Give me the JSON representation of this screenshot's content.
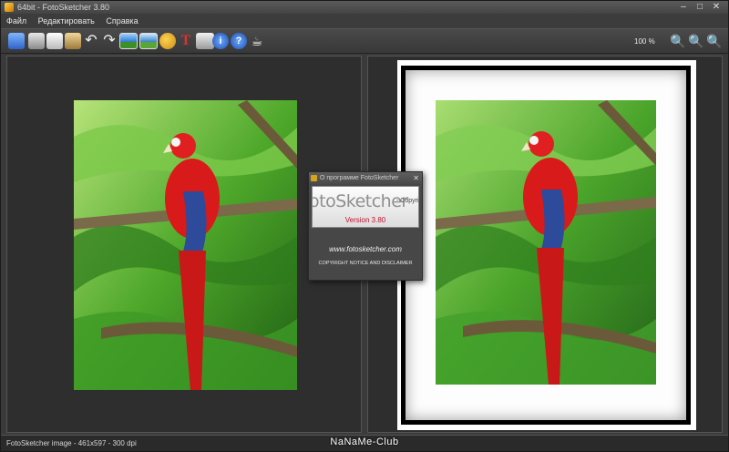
{
  "window": {
    "title": "64bit - FotoSketcher 3.80",
    "minimize": "–",
    "maximize": "□",
    "close": "✕"
  },
  "menu": {
    "items": [
      {
        "label": "Файл"
      },
      {
        "label": "Редактировать"
      },
      {
        "label": "Справка"
      }
    ]
  },
  "toolbar": {
    "zoom_level": "100 %",
    "icons": [
      "open-icon",
      "save-icon",
      "copy-icon",
      "paste-icon",
      "undo-icon",
      "redo-icon",
      "image-icon",
      "image-alt-icon",
      "palette-icon",
      "text-icon",
      "print-icon",
      "info-icon",
      "help-icon",
      "coffee-icon",
      "zoom-out-icon",
      "zoom-fit-icon",
      "zoom-in-icon"
    ]
  },
  "about_dialog": {
    "title": "О программе FotoSketcher",
    "close": "✕",
    "logo_text": "otoSketcher",
    "copyright_fragment": "- Copyri",
    "version": "Version 3.80",
    "website": "www.fotosketcher.com",
    "notice": "COPYRIGHT NOTICE AND DISCLAIMER"
  },
  "status": {
    "text": "FotoSketcher image - 461x597 - 300 dpi"
  },
  "watermark": "NaNaMe-Club",
  "colors": {
    "parrot_red": "#d91a1a",
    "parrot_blue": "#2e4a9a",
    "foliage": "#3b8a1f",
    "version_red": "#c8102e"
  }
}
